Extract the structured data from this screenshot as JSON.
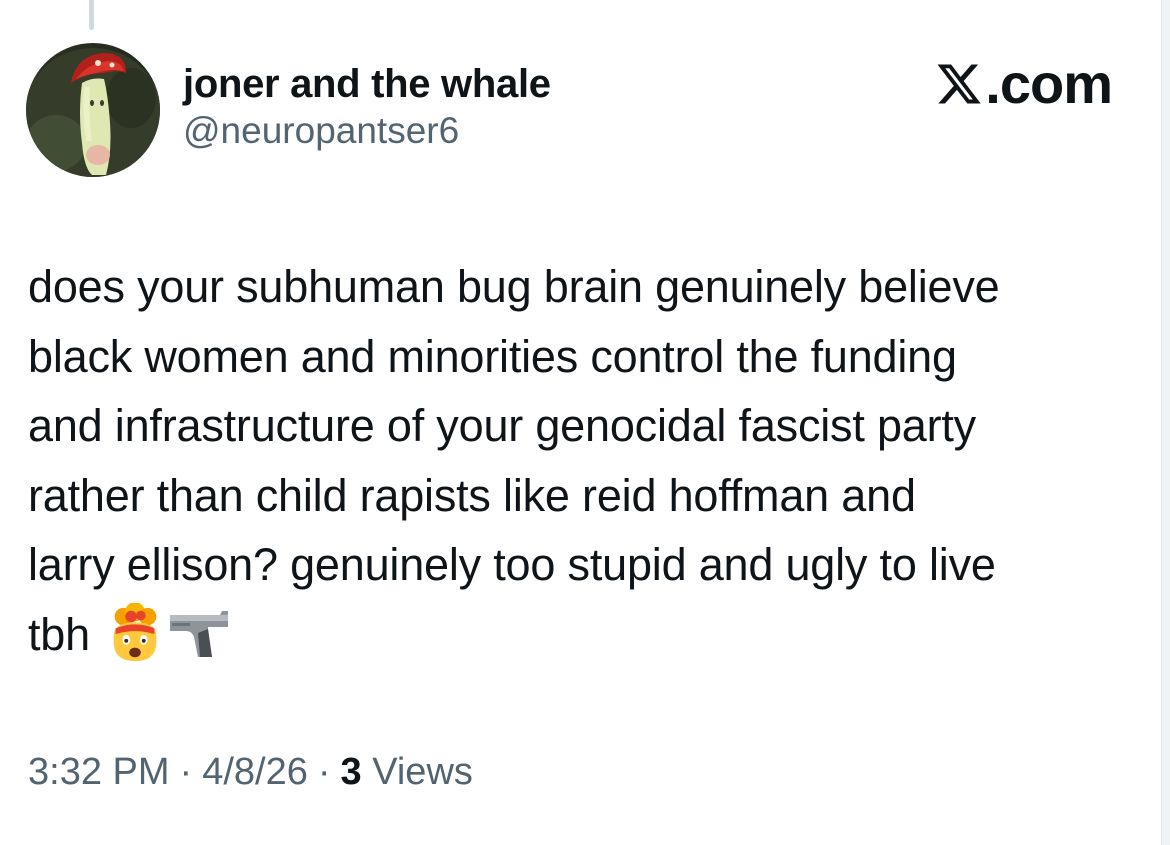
{
  "author": {
    "display_name": "joner and the whale",
    "handle": "@neuropantser6"
  },
  "brand": {
    "icon": "x-logo-icon",
    "suffix": ".com"
  },
  "tweet": {
    "lines": [
      "does your subhuman bug brain genuinely believe",
      "black women and minorities control the funding",
      "and infrastructure of your genocidal fascist party",
      "rather than child rapists like reid hoffman and",
      "larry ellison? genuinely too stupid and ugly to live",
      "tbh"
    ],
    "emojis": [
      "exploding-head-emoji",
      "pistol-emoji"
    ]
  },
  "meta": {
    "time": "3:32 PM",
    "date": "4/8/26",
    "separator": "·",
    "views_count": "3",
    "views_label": "Views"
  },
  "colors": {
    "text_primary": "#0f1419",
    "text_secondary": "#536471",
    "thread_line": "#cfd9de"
  }
}
